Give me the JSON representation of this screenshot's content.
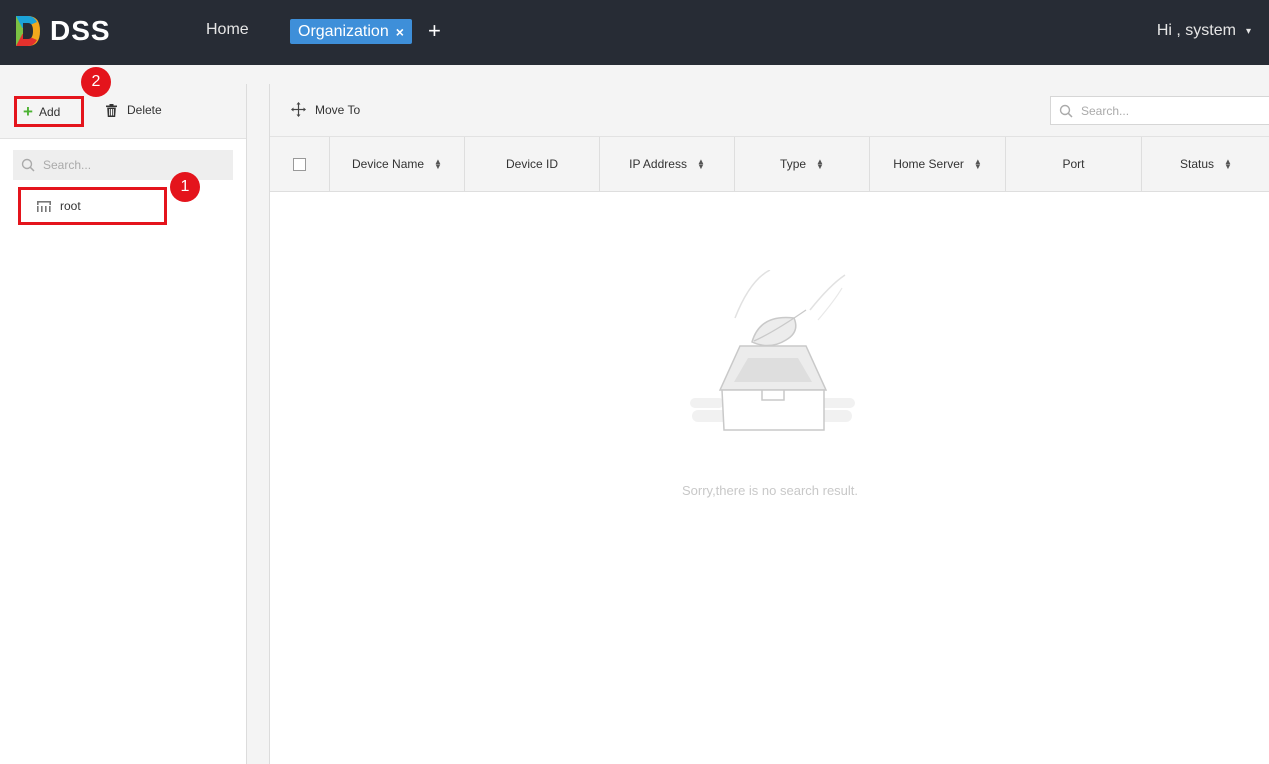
{
  "header": {
    "logo_text": "DSS",
    "nav_home": "Home",
    "active_tab": "Organization",
    "tab_close": "×",
    "tab_add": "+",
    "user_greeting": "Hi , system",
    "user_caret": "▾"
  },
  "left": {
    "toolbar": {
      "add_label": "Add",
      "delete_label": "Delete"
    },
    "search": {
      "placeholder": "Search..."
    },
    "tree": [
      {
        "label": "root",
        "icon": "org-tree-icon"
      }
    ]
  },
  "callouts": [
    {
      "number": "1"
    },
    {
      "number": "2"
    }
  ],
  "right": {
    "toolbar": {
      "move_to_label": "Move To"
    },
    "search": {
      "placeholder": "Search..."
    },
    "columns": [
      {
        "label": "Device Name",
        "sortable": true
      },
      {
        "label": "Device ID",
        "sortable": false
      },
      {
        "label": "IP Address",
        "sortable": true
      },
      {
        "label": "Type",
        "sortable": true
      },
      {
        "label": "Home Server",
        "sortable": true
      },
      {
        "label": "Port",
        "sortable": false
      },
      {
        "label": "Status",
        "sortable": true
      }
    ],
    "empty_message": "Sorry,there is no search result."
  },
  "colors": {
    "topbar": "#272c35",
    "tab_active": "#3e8fd9",
    "highlight_red": "#e4141c",
    "add_green": "#4cb233"
  }
}
